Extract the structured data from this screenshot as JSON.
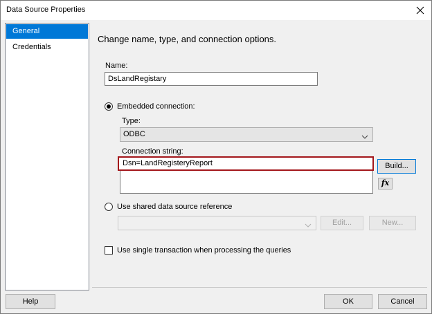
{
  "window": {
    "title": "Data Source Properties"
  },
  "nav": {
    "items": [
      {
        "label": "General",
        "selected": true
      },
      {
        "label": "Credentials",
        "selected": false
      }
    ]
  },
  "general": {
    "heading": "Change name, type, and connection options.",
    "name_label": "Name:",
    "name_value": "DsLandRegistary",
    "embedded_label": "Embedded connection:",
    "type_label": "Type:",
    "type_value": "ODBC",
    "connection_label": "Connection string:",
    "connection_value": "Dsn=LandRegisteryReport",
    "build_label": "Build...",
    "fx_label": "fx",
    "shared_label": "Use shared data source reference",
    "shared_value": "",
    "edit_label": "Edit...",
    "new_label": "New...",
    "single_transaction_label": "Use single transaction when processing the queries"
  },
  "footer": {
    "help_label": "Help",
    "ok_label": "OK",
    "cancel_label": "Cancel"
  }
}
